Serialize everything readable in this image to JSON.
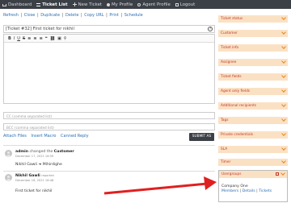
{
  "nav": {
    "items": [
      {
        "label": "Dashboard",
        "icon": "home-icon"
      },
      {
        "label": "Ticket List",
        "icon": "list-icon"
      },
      {
        "label": "New Ticket",
        "icon": "plus-icon"
      },
      {
        "label": "My Profile",
        "icon": "user-icon"
      },
      {
        "label": "Agent Profile",
        "icon": "agent-icon"
      },
      {
        "label": "Logout",
        "icon": "logout-icon"
      }
    ]
  },
  "actions": [
    "Refresh",
    "Close",
    "Duplicate",
    "Delete",
    "Copy URL",
    "Print",
    "Schedule"
  ],
  "ticket": {
    "subject": "[Ticket #32] First ticket for nikhil",
    "cc_placeholder": "CC (comma separated list)",
    "bcc_placeholder": "BCC (comma separated list)"
  },
  "editor": {
    "toolbar": [
      "B",
      "I",
      "U",
      "S",
      "≡",
      "≡",
      "≡",
      "❝",
      "⛓",
      "▣",
      "⚲"
    ],
    "links": [
      "Attach Files",
      "Insert Macro",
      "Canned Reply"
    ],
    "submit_label": "SUBMIT AS"
  },
  "history": [
    {
      "author": "admin",
      "action": "changed the",
      "field": "Customer",
      "date": "December 17, 2021 16:59",
      "body": "Nikhil Gawli  ➜  Mihirdighe"
    },
    {
      "author": "Nikhil Gawli",
      "action": "reported",
      "field": "",
      "date": "December 16, 2021 18:48",
      "body": "First ticket for nikhil"
    }
  ],
  "sidebar": {
    "panels": [
      "Ticket status",
      "Customer",
      "Ticket info",
      "Assignee",
      "Ticket fields",
      "Agent only fields",
      "Additional recipients",
      "Tags",
      "Private credentials",
      "SLA",
      "Timer"
    ],
    "usergroups": {
      "title": "Usergroups",
      "company": "Company One",
      "links": [
        "Members",
        "Details",
        "Tickets"
      ]
    }
  },
  "colors": {
    "nav_bg": "#3b4047",
    "panel_bg": "#fbe1c4",
    "panel_text": "#c0392b",
    "link": "#2b6fb3",
    "arrow": "#e02020"
  }
}
